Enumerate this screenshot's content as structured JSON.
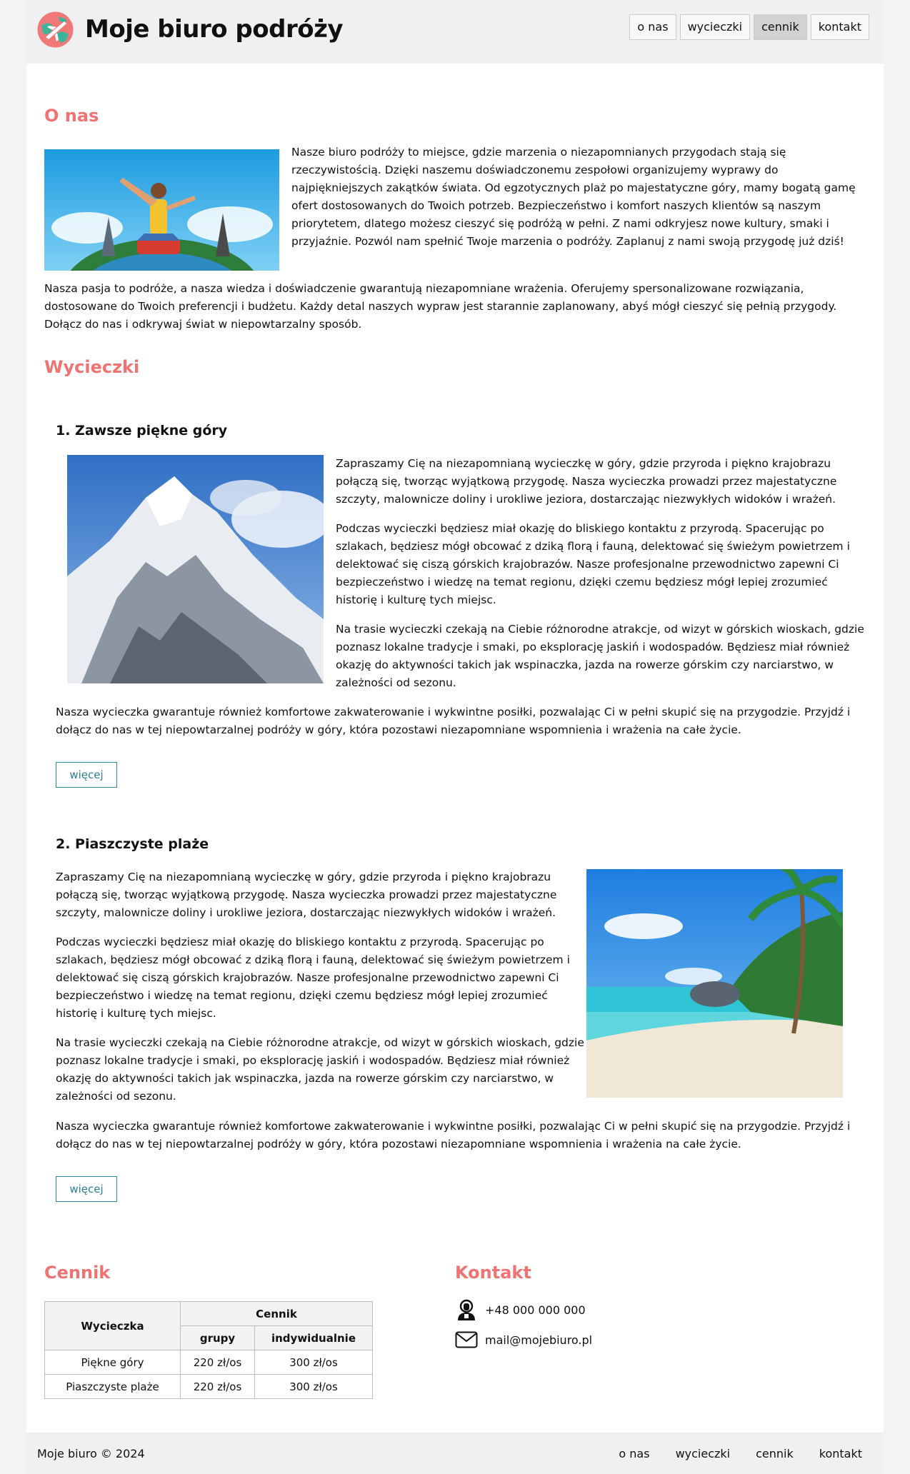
{
  "header": {
    "title": "Moje biuro podróży",
    "nav": [
      "o nas",
      "wycieczki",
      "cennik",
      "kontakt"
    ]
  },
  "about": {
    "title": "O nas",
    "p1": "Nasze biuro podróży to miejsce, gdzie marzenia o niezapomnianych przygodach stają się rzeczywistością. Dzięki naszemu doświadczonemu zespołowi organizujemy wyprawy do najpiękniejszych zakątków świata. Od egzotycznych plaż po majestatyczne góry, mamy bogatą gamę ofert dostosowanych do Twoich potrzeb. Bezpieczeństwo i komfort naszych klientów są naszym priorytetem, dlatego możesz cieszyć się podróżą w pełni. Z nami odkryjesz nowe kultury, smaki i przyjaźnie. Pozwól nam spełnić Twoje marzenia o podróży. Zaplanuj z nami swoją przygodę już dziś!",
    "p2": "Nasza pasja to podróże, a nasza wiedza i doświadczenie gwarantują niezapomniane wrażenia. Oferujemy spersonalizowane rozwiązania, dostosowane do Twoich preferencji i budżetu. Każdy detal naszych wypraw jest starannie zaplanowany, abyś mógł cieszyć się pełnią przygody. Dołącz do nas i odkrywaj świat w niepowtarzalny sposób."
  },
  "trips": {
    "title": "Wycieczki",
    "items": [
      {
        "title": "1. Zawsze piękne góry",
        "p1": "Zapraszamy Cię na niezapomnianą wycieczkę w góry, gdzie przyroda i piękno krajobrazu połączą się, tworząc wyjątkową przygodę. Nasza wycieczka prowadzi przez majestatyczne szczyty, malownicze doliny i urokliwe jeziora, dostarczając niezwykłych widoków i wrażeń.",
        "p2": "Podczas wycieczki będziesz miał okazję do bliskiego kontaktu z przyrodą. Spacerując po szlakach, będziesz mógł obcować z dziką florą i fauną, delektować się świeżym powietrzem i delektować się ciszą górskich krajobrazów. Nasze profesjonalne przewodnictwo zapewni Ci bezpieczeństwo i wiedzę na temat regionu, dzięki czemu będziesz mógł lepiej zrozumieć historię i kulturę tych miejsc.",
        "p3": "Na trasie wycieczki czekają na Ciebie różnorodne atrakcje, od wizyt w górskich wioskach, gdzie poznasz lokalne tradycje i smaki, po eksplorację jaskiń i wodospadów. Będziesz miał również okazję do aktywności takich jak wspinaczka, jazda na rowerze górskim czy narciarstwo, w zależności od sezonu.",
        "p4": "Nasza wycieczka gwarantuje również komfortowe zakwaterowanie i wykwintne posiłki, pozwalając Ci w pełni skupić się na przygodzie. Przyjdź i dołącz do nas w tej niepowtarzalnej podróży w góry, która pozostawi niezapomniane wspomnienia i wrażenia na całe życie.",
        "more": "więcej"
      },
      {
        "title": "2. Piaszczyste plaże",
        "p1": "Zapraszamy Cię na niezapomnianą wycieczkę w góry, gdzie przyroda i piękno krajobrazu połączą się, tworząc wyjątkową przygodę. Nasza wycieczka prowadzi przez majestatyczne szczyty, malownicze doliny i urokliwe jeziora, dostarczając niezwykłych widoków i wrażeń.",
        "p2": "Podczas wycieczki będziesz miał okazję do bliskiego kontaktu z przyrodą. Spacerując po szlakach, będziesz mógł obcować z dziką florą i fauną, delektować się świeżym powietrzem i delektować się ciszą górskich krajobrazów. Nasze profesjonalne przewodnictwo zapewni Ci bezpieczeństwo i wiedzę na temat regionu, dzięki czemu będziesz mógł lepiej zrozumieć historię i kulturę tych miejsc.",
        "p3": "Na trasie wycieczki czekają na Ciebie różnorodne atrakcje, od wizyt w górskich wioskach, gdzie poznasz lokalne tradycje i smaki, po eksplorację jaskiń i wodospadów. Będziesz miał również okazję do aktywności takich jak wspinaczka, jazda na rowerze górskim czy narciarstwo, w zależności od sezonu.",
        "p4": "Nasza wycieczka gwarantuje również komfortowe zakwaterowanie i wykwintne posiłki, pozwalając Ci w pełni skupić się na przygodzie. Przyjdź i dołącz do nas w tej niepowtarzalnej podróży w góry, która pozostawi niezapomniane wspomnienia i wrażenia na całe życie.",
        "more": "więcej"
      }
    ]
  },
  "pricing": {
    "title": "Cennik",
    "col_trip": "Wycieczka",
    "col_price": "Cennik",
    "col_groups": "grupy",
    "col_individual": "indywidualnie",
    "rows": [
      {
        "name": "Piękne góry",
        "groups": "220 zł/os",
        "individual": "300 zł/os"
      },
      {
        "name": "Piaszczyste plaże",
        "groups": "220 zł/os",
        "individual": "300 zł/os"
      }
    ]
  },
  "contact": {
    "title": "Kontakt",
    "phone": "+48 000 000 000",
    "email": "mail@mojebiuro.pl"
  },
  "footer": {
    "copyright": "Moje biuro © 2024",
    "nav": [
      "o nas",
      "wycieczki",
      "cennik",
      "kontakt"
    ]
  },
  "colors": {
    "accent": "#f07373",
    "button": "#2a8a9a"
  },
  "icons": [
    "logo-plane-globe-icon",
    "phone-operator-icon",
    "envelope-icon"
  ]
}
